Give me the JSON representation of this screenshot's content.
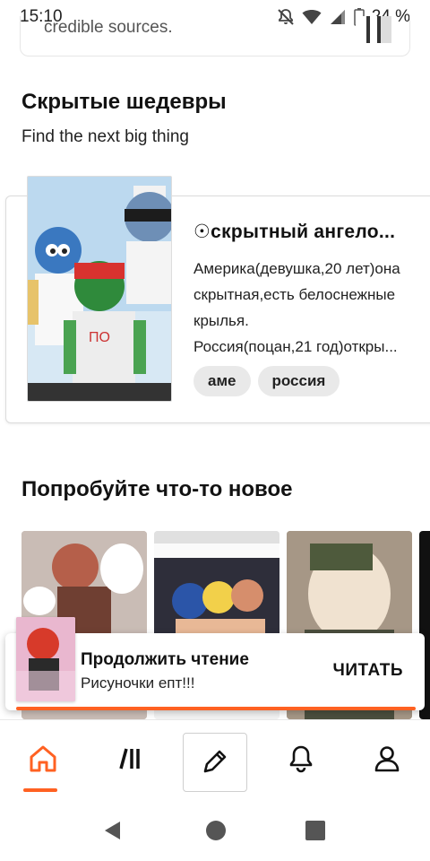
{
  "status_bar": {
    "time": "15:10",
    "battery": "24 %"
  },
  "previous_card": {
    "text": "credible sources."
  },
  "hidden_gems": {
    "title": "Скрытые шедевры",
    "subtitle": "Find the next big thing"
  },
  "featured_story": {
    "title": "☉скрытный ангело...",
    "description_lines": [
      "Америка(девушка,20 лет)она",
      "скрытная,есть белоснежные",
      "крылья.",
      "Россия(поцан,21 год)откры..."
    ],
    "cover_caption": "ПО",
    "tags": [
      "аме",
      "россия"
    ]
  },
  "try_something": {
    "title": "Попробуйте что-то новое"
  },
  "continue_reading": {
    "title": "Продолжить чтение",
    "story": "Рисуночки епт!!!",
    "button": "ЧИТАТЬ"
  },
  "colors": {
    "accent": "#ff6122"
  },
  "bottom_nav": {
    "items": [
      {
        "icon": "home-icon"
      },
      {
        "icon": "library-icon"
      },
      {
        "icon": "pencil-icon"
      },
      {
        "icon": "bell-icon"
      },
      {
        "icon": "profile-icon"
      }
    ]
  }
}
